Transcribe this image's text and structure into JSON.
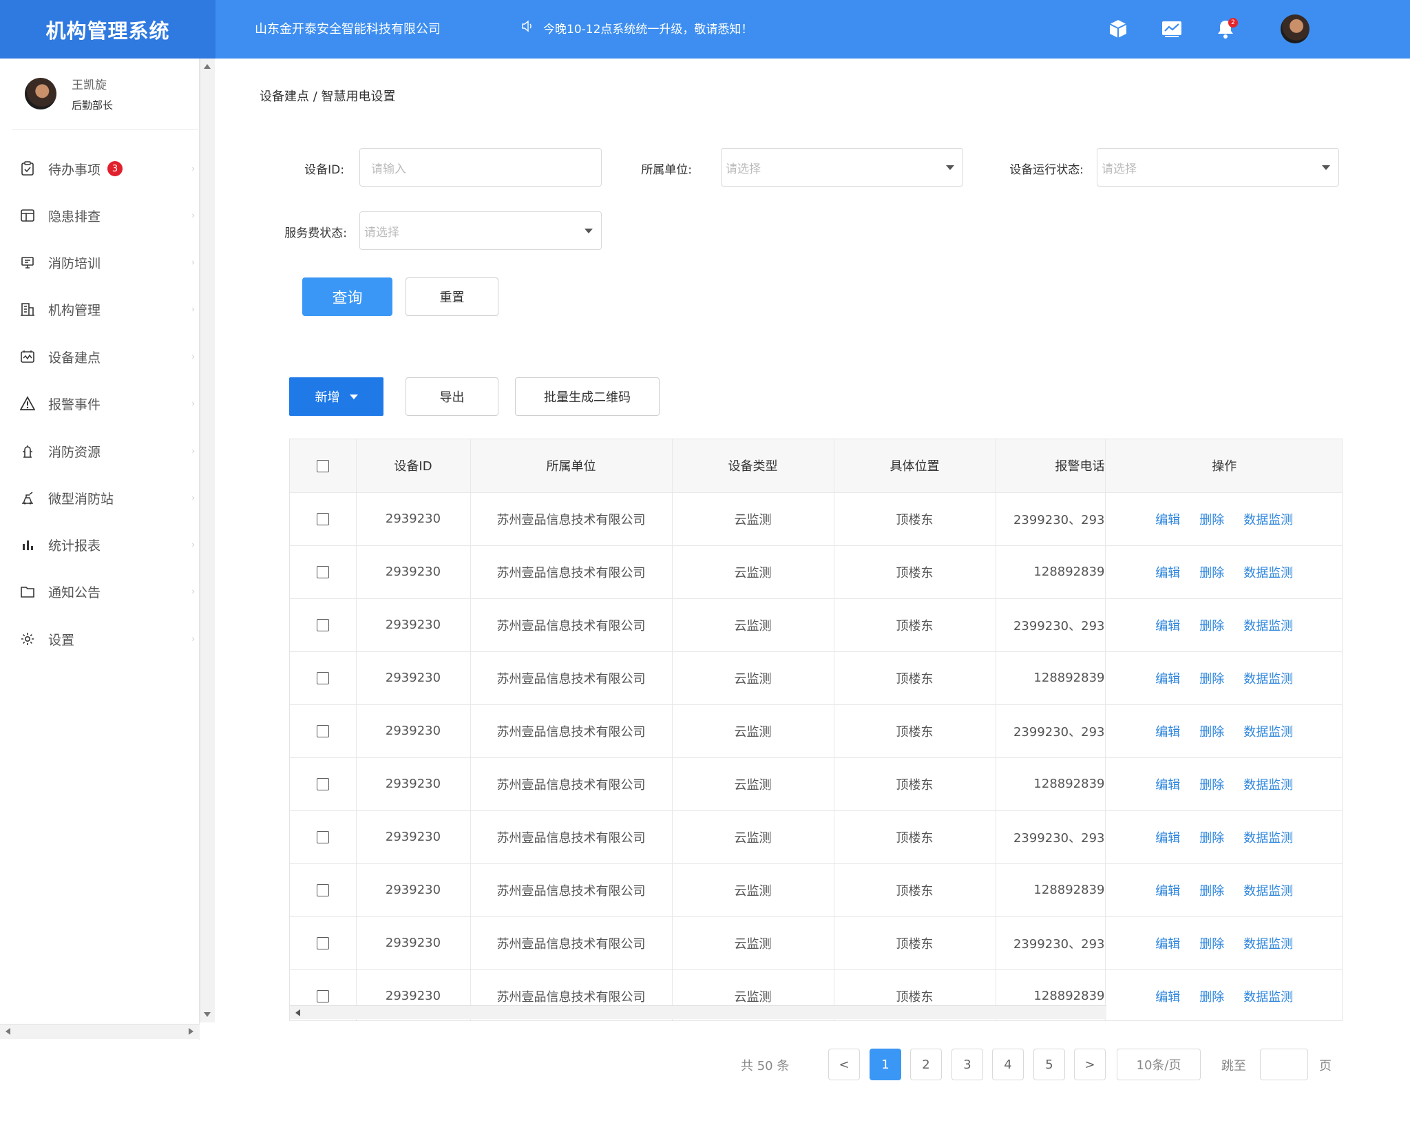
{
  "header": {
    "brand": "机构管理系统",
    "company": "山东金开泰安全智能科技有限公司",
    "notice": "今晚10-12点系统统一升级，敬请悉知！",
    "bell_count": "2"
  },
  "sidebar": {
    "user_name": "王凯旋",
    "user_role": "后勤部长",
    "items": [
      {
        "label": "待办事项",
        "icon": "clipboard-check-icon",
        "badge": "3"
      },
      {
        "label": "隐患排查",
        "icon": "layout-icon"
      },
      {
        "label": "消防培训",
        "icon": "presentation-icon"
      },
      {
        "label": "机构管理",
        "icon": "building-icon"
      },
      {
        "label": "设备建点",
        "icon": "device-monitor-icon"
      },
      {
        "label": "报警事件",
        "icon": "warning-icon"
      },
      {
        "label": "消防资源",
        "icon": "hydrant-icon"
      },
      {
        "label": "微型消防站",
        "icon": "fire-station-icon"
      },
      {
        "label": "统计报表",
        "icon": "bar-chart-icon"
      },
      {
        "label": "通知公告",
        "icon": "folder-icon"
      },
      {
        "label": "设置",
        "icon": "gear-icon"
      }
    ]
  },
  "breadcrumb": "设备建点 / 智慧用电设置",
  "filters": {
    "device_id_label": "设备ID:",
    "device_id_placeholder": "请输入",
    "unit_label": "所属单位:",
    "unit_placeholder": "请选择",
    "status_label": "设备运行状态:",
    "status_placeholder": "请选择",
    "fee_label": "服务费状态:",
    "fee_placeholder": "请选择",
    "query": "查询",
    "reset": "重置"
  },
  "toolbar": {
    "add": "新增",
    "export": "导出",
    "batch_qr": "批量生成二维码"
  },
  "table": {
    "columns": [
      "设备ID",
      "所属单位",
      "设备类型",
      "具体位置",
      "报警电话",
      "操作"
    ],
    "rows": [
      {
        "id": "2939230",
        "unit": "苏州壹品信息技术有限公司",
        "type": "云监测",
        "location": "顶楼东",
        "phone": "2399230、293"
      },
      {
        "id": "2939230",
        "unit": "苏州壹品信息技术有限公司",
        "type": "云监测",
        "location": "顶楼东",
        "phone": "128892839"
      },
      {
        "id": "2939230",
        "unit": "苏州壹品信息技术有限公司",
        "type": "云监测",
        "location": "顶楼东",
        "phone": "2399230、293"
      },
      {
        "id": "2939230",
        "unit": "苏州壹品信息技术有限公司",
        "type": "云监测",
        "location": "顶楼东",
        "phone": "128892839"
      },
      {
        "id": "2939230",
        "unit": "苏州壹品信息技术有限公司",
        "type": "云监测",
        "location": "顶楼东",
        "phone": "2399230、293"
      },
      {
        "id": "2939230",
        "unit": "苏州壹品信息技术有限公司",
        "type": "云监测",
        "location": "顶楼东",
        "phone": "128892839"
      },
      {
        "id": "2939230",
        "unit": "苏州壹品信息技术有限公司",
        "type": "云监测",
        "location": "顶楼东",
        "phone": "2399230、293"
      },
      {
        "id": "2939230",
        "unit": "苏州壹品信息技术有限公司",
        "type": "云监测",
        "location": "顶楼东",
        "phone": "128892839"
      },
      {
        "id": "2939230",
        "unit": "苏州壹品信息技术有限公司",
        "type": "云监测",
        "location": "顶楼东",
        "phone": "2399230、293"
      },
      {
        "id": "2939230",
        "unit": "苏州壹品信息技术有限公司",
        "type": "云监测",
        "location": "顶楼东",
        "phone": "128892839"
      }
    ],
    "actions": [
      "编辑",
      "删除",
      "数据监测"
    ]
  },
  "pagination": {
    "total": "共 50 条",
    "prev": "<",
    "next": ">",
    "pages": [
      "1",
      "2",
      "3",
      "4",
      "5"
    ],
    "active_page": "1",
    "page_size": "10条/页",
    "jump_label": "跳至",
    "jump_unit": "页"
  },
  "colors": {
    "header_bg": "#3d8ef0",
    "brand_bg": "#2f7ae0",
    "primary": "#3b97f5",
    "link": "#2e86de",
    "badge": "#e0202c"
  }
}
